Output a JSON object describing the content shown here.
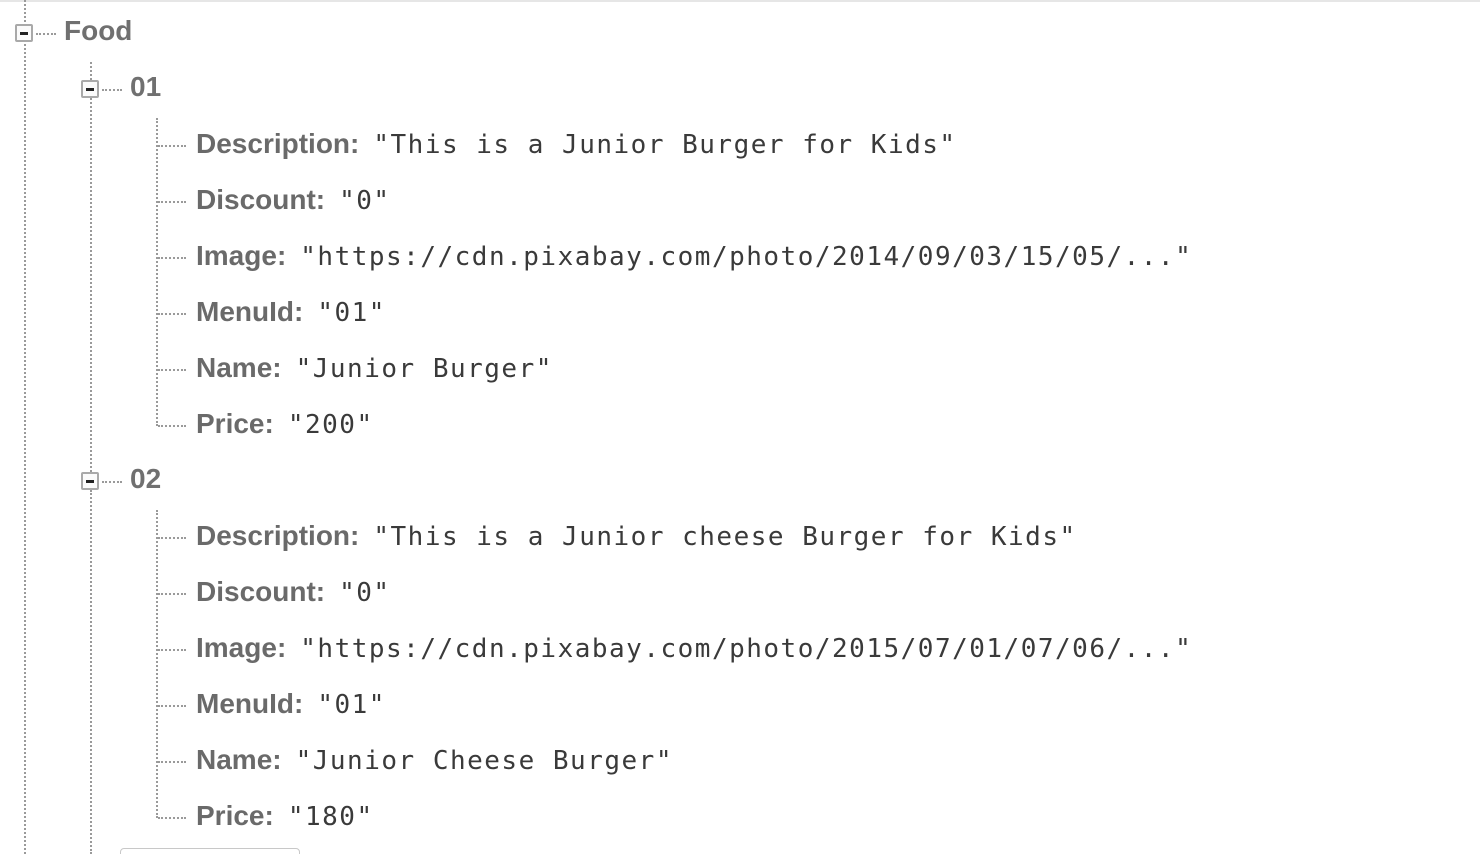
{
  "root": {
    "key": "Food",
    "children": [
      {
        "key": "01",
        "fields": [
          {
            "key": "Description",
            "value": "\"This is a Junior Burger for Kids\""
          },
          {
            "key": "Discount",
            "value": "\"0\""
          },
          {
            "key": "Image",
            "value": "\"https://cdn.pixabay.com/photo/2014/09/03/15/05/...\""
          },
          {
            "key": "MenuId",
            "value": "\"01\""
          },
          {
            "key": "Name",
            "value": "\"Junior Burger\""
          },
          {
            "key": "Price",
            "value": "\"200\""
          }
        ]
      },
      {
        "key": "02",
        "fields": [
          {
            "key": "Description",
            "value": "\"This is a Junior cheese Burger for Kids\""
          },
          {
            "key": "Discount",
            "value": "\"0\""
          },
          {
            "key": "Image",
            "value": "\"https://cdn.pixabay.com/photo/2015/07/01/07/06/...\""
          },
          {
            "key": "MenuId",
            "value": "\"01\""
          },
          {
            "key": "Name",
            "value": "\"Junior Cheese Burger\""
          },
          {
            "key": "Price",
            "value": "\"180\""
          }
        ]
      }
    ]
  },
  "punct": {
    "colon": ":"
  },
  "icons": {
    "toggle": "minus-square-icon"
  }
}
